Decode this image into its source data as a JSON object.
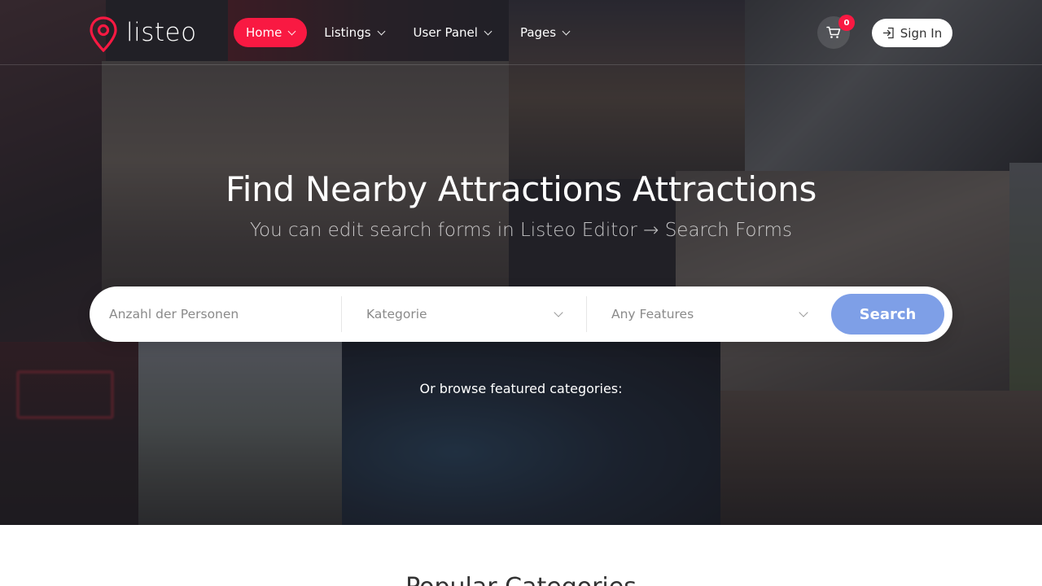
{
  "brand": {
    "name": "listeo",
    "accent": "#f91942"
  },
  "nav": {
    "items": [
      {
        "label": "Home",
        "active": true
      },
      {
        "label": "Listings",
        "active": false
      },
      {
        "label": "User Panel",
        "active": false
      },
      {
        "label": "Pages",
        "active": false
      }
    ]
  },
  "cart": {
    "count": "0",
    "icon": "cart-icon"
  },
  "signin": {
    "label": "Sign In",
    "icon": "login-icon"
  },
  "hero": {
    "title": "Find Nearby Attractions Attractions",
    "subtitle": "You can edit search forms in Listeo Editor → Search Forms"
  },
  "search": {
    "persons_placeholder": "Anzahl der Personen",
    "category_label": "Kategorie",
    "features_label": "Any Features",
    "button_label": "Search",
    "button_color": "#7e9fe7"
  },
  "browse_text": "Or browse featured categories:",
  "section": {
    "title": "Popular Categories"
  }
}
